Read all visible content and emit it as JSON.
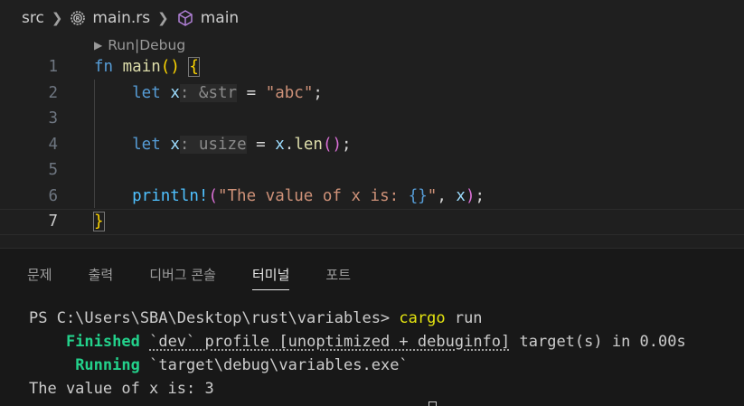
{
  "breadcrumb": {
    "folder": "src",
    "file": "main.rs",
    "symbol": "main",
    "file_icon": "rust-gear-icon",
    "symbol_icon": "cube-icon"
  },
  "codelens": {
    "run": "Run",
    "separator": " | ",
    "debug": "Debug"
  },
  "editor": {
    "line_numbers": [
      "1",
      "2",
      "3",
      "4",
      "5",
      "6",
      "7"
    ],
    "lines": [
      [
        {
          "t": "fn",
          "c": "kw"
        },
        {
          "t": " ",
          "c": "op"
        },
        {
          "t": "main",
          "c": "fn"
        },
        {
          "t": "()",
          "c": "p1"
        },
        {
          "t": " ",
          "c": "op"
        },
        {
          "t": "{",
          "c": "p1 bracket-hl"
        }
      ],
      [
        {
          "t": "    let",
          "c": "kw"
        },
        {
          "t": " ",
          "c": "op"
        },
        {
          "t": "x",
          "c": "var"
        },
        {
          "t": ": &str",
          "c": "hint"
        },
        {
          "t": " = ",
          "c": "op"
        },
        {
          "t": "\"abc\"",
          "c": "str"
        },
        {
          "t": ";",
          "c": "op"
        }
      ],
      [],
      [
        {
          "t": "    let",
          "c": "kw"
        },
        {
          "t": " ",
          "c": "op"
        },
        {
          "t": "x",
          "c": "var"
        },
        {
          "t": ": usize",
          "c": "hint"
        },
        {
          "t": " = ",
          "c": "op"
        },
        {
          "t": "x",
          "c": "var"
        },
        {
          "t": ".",
          "c": "op"
        },
        {
          "t": "len",
          "c": "fn"
        },
        {
          "t": "()",
          "c": "p2"
        },
        {
          "t": ";",
          "c": "op"
        }
      ],
      [],
      [
        {
          "t": "    println!",
          "c": "macro"
        },
        {
          "t": "(",
          "c": "p2"
        },
        {
          "t": "\"The value of x is: ",
          "c": "str"
        },
        {
          "t": "{}",
          "c": "fmt"
        },
        {
          "t": "\"",
          "c": "str"
        },
        {
          "t": ", ",
          "c": "op"
        },
        {
          "t": "x",
          "c": "var"
        },
        {
          "t": ")",
          "c": "p2"
        },
        {
          "t": ";",
          "c": "op"
        }
      ],
      [
        {
          "t": "}",
          "c": "p1 bracket-hl"
        }
      ]
    ]
  },
  "panel": {
    "tabs": [
      "문제",
      "출력",
      "디버그 콘솔",
      "터미널",
      "포트"
    ],
    "active_tab": "터미널"
  },
  "terminal": {
    "prompt": "PS C:\\Users\\SBA\\Desktop\\rust\\variables> ",
    "command": "cargo",
    "command_args": " run",
    "finished_label": "Finished",
    "finished_detail_a": "`dev` profile [unoptimized + debuginfo]",
    "finished_detail_b": " target(s) in 0.00s",
    "running_label": "Running",
    "running_detail": "`target\\debug\\variables.exe`",
    "output": "The value of x is: 3"
  },
  "colors": {
    "accent_yellow": "#e5e510",
    "accent_green": "#23d18b",
    "background": "#1f1f1f"
  }
}
